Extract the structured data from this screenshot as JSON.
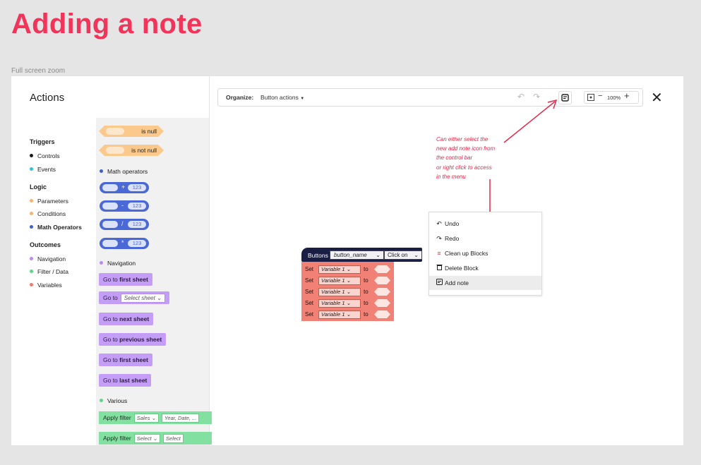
{
  "title": "Adding a note",
  "subtitle": "Full screen zoom",
  "sidebar": {
    "title": "Actions",
    "sections": [
      {
        "head": "Triggers",
        "items": [
          {
            "label": "Controls",
            "color": "#1a1a1a"
          },
          {
            "label": "Events",
            "color": "#35c3d8"
          }
        ]
      },
      {
        "head": "Logic",
        "items": [
          {
            "label": "Parameters",
            "color": "#f4b46a"
          },
          {
            "label": "Conditions",
            "color": "#f4b46a"
          },
          {
            "label": "Math Operators",
            "color": "#3f5fd0"
          }
        ]
      },
      {
        "head": "Outcomes",
        "items": [
          {
            "label": "Navigation",
            "color": "#b88cf2"
          },
          {
            "label": "Filter / Data",
            "color": "#5cd687"
          },
          {
            "label": "Variables",
            "color": "#f07a6e"
          }
        ]
      }
    ]
  },
  "palette": {
    "null_blocks": [
      "is null",
      "is not null"
    ],
    "math_header": "Math operators",
    "math_blocks": [
      {
        "op": "+",
        "value": "123"
      },
      {
        "op": "-",
        "value": "123"
      },
      {
        "op": "/",
        "value": "123"
      },
      {
        "op": "*",
        "value": "123"
      }
    ],
    "nav_header": "Navigation",
    "goto_prefix": "Go to",
    "first_sheet": "first sheet",
    "select_sheet": "Select sheet",
    "next_sheet": "next sheet",
    "previous_sheet": "previous sheet",
    "last_sheet": "last sheet",
    "various_header": "Various",
    "apply_filter": "Apply filter",
    "filter1_a": "Sales",
    "filter1_b": "Year, Date, ...",
    "filter2_a": "Select",
    "filter2_b": "Select"
  },
  "toolbar": {
    "organize_label": "Organize:",
    "organize_value": "Button actions",
    "zoom_value": "100%"
  },
  "annotation": [
    "Can either select the",
    "new add note icon from",
    "the control bar",
    "or right click to access",
    "in the menu"
  ],
  "context_menu": [
    {
      "label": "Undo",
      "icon": "undo-icon",
      "glyph": "↶"
    },
    {
      "label": "Redo",
      "icon": "redo-icon",
      "glyph": "↷"
    },
    {
      "label": "Clean up Blocks",
      "icon": "lines-icon",
      "glyph": "≡"
    },
    {
      "label": "Delete Block",
      "icon": "trash-icon",
      "glyph": "🗑"
    },
    {
      "label": "Add note",
      "icon": "note-icon",
      "glyph": "▤"
    }
  ],
  "block": {
    "head_label": "Buttons",
    "button_name": "button_name",
    "event": "Click on",
    "set_label": "Set",
    "variable": "Variable 1",
    "to_label": "to",
    "row_count": 5
  },
  "colors": {
    "title": "#f0345a",
    "annotation": "#e3284b",
    "block_head": "#1a1d44",
    "block_body": "#f08174"
  }
}
